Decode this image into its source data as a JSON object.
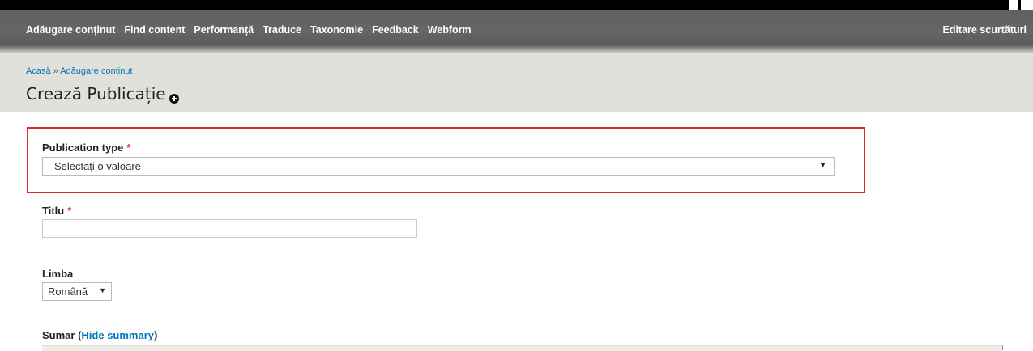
{
  "toolbar": {
    "menu": [
      {
        "label": "Adăugare conținut"
      },
      {
        "label": "Find content"
      },
      {
        "label": "Performanță"
      },
      {
        "label": "Traduce"
      },
      {
        "label": "Taxonomie"
      },
      {
        "label": "Feedback"
      },
      {
        "label": "Webform"
      }
    ],
    "shortcuts_label": "Editare scurtături"
  },
  "breadcrumb": {
    "home": "Acasă",
    "separator": " » ",
    "current": "Adăugare conținut"
  },
  "page": {
    "title": "Crează Publicație"
  },
  "form": {
    "publication_type": {
      "label": "Publication type",
      "required_mark": "*",
      "selected": "- Selectați o valoare -"
    },
    "title_field": {
      "label": "Titlu",
      "required_mark": "*",
      "value": ""
    },
    "language": {
      "label": "Limba",
      "selected": "Română"
    },
    "summary": {
      "label": "Sumar",
      "open_paren": " (",
      "toggle_label": "Hide summary",
      "close_paren": ")"
    }
  },
  "colors": {
    "toolbar_bg": "#666666",
    "header_band": "#e1e1db",
    "highlight_border": "#e12228",
    "link": "#0074bd",
    "required": "#e0282e"
  },
  "icons": {
    "add_shortcut": "plus-circle-icon",
    "dropdown": "triangle-down-icon"
  }
}
